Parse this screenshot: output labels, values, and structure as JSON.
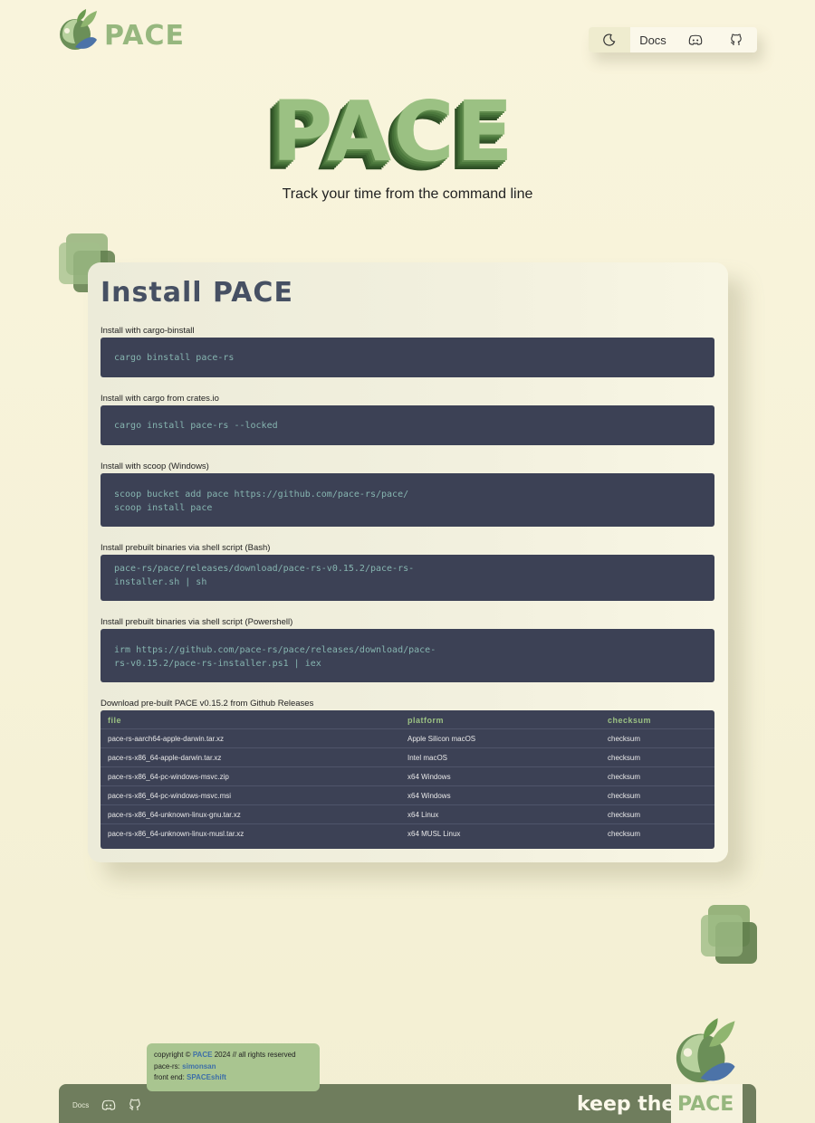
{
  "header": {
    "brand": "PACE",
    "nav": {
      "docs_label": "Docs"
    }
  },
  "hero": {
    "title": "PACE",
    "tagline": "Track your time from the command line"
  },
  "install": {
    "title": "Install PACE",
    "sections": [
      {
        "label": "Install with cargo-binstall",
        "lines": [
          "cargo binstall pace-rs"
        ]
      },
      {
        "label": "Install with cargo from crates.io",
        "lines": [
          "cargo install pace-rs --locked"
        ]
      },
      {
        "label": "Install with scoop (Windows)",
        "lines": [
          "scoop bucket add pace https://github.com/pace-rs/pace/",
          "scoop install pace"
        ]
      },
      {
        "label": "Install prebuilt binaries via shell script (Bash)",
        "lines": [
          "pace-rs/pace/releases/download/pace-rs-v0.15.2/pace-rs-",
          "installer.sh | sh"
        ]
      },
      {
        "label": "Install prebuilt binaries via shell script (Powershell)",
        "lines": [
          "irm https://github.com/pace-rs/pace/releases/download/pace-",
          "rs-v0.15.2/pace-rs-installer.ps1 | iex"
        ]
      }
    ],
    "downloads": {
      "label": "Download pre-built PACE v0.15.2 from Github Releases",
      "columns": [
        "file",
        "platform",
        "checksum"
      ],
      "rows": [
        [
          "pace-rs-aarch64-apple-darwin.tar.xz",
          "Apple Silicon macOS",
          "checksum"
        ],
        [
          "pace-rs-x86_64-apple-darwin.tar.xz",
          "Intel macOS",
          "checksum"
        ],
        [
          "pace-rs-x86_64-pc-windows-msvc.zip",
          "x64 Windows",
          "checksum"
        ],
        [
          "pace-rs-x86_64-pc-windows-msvc.msi",
          "x64 Windows",
          "checksum"
        ],
        [
          "pace-rs-x86_64-unknown-linux-gnu.tar.xz",
          "x64 Linux",
          "checksum"
        ],
        [
          "pace-rs-x86_64-unknown-linux-musl.tar.xz",
          "x64 MUSL Linux",
          "checksum"
        ]
      ]
    }
  },
  "footer": {
    "docs_label": "Docs",
    "keep_the": "keep the",
    "pace": "PACE",
    "credits": {
      "copyright_prefix": "copyright ©",
      "copyright_brand": "PACE",
      "copyright_suffix": "2024 // all rights reserved",
      "pace_rs_label": "pace-rs:",
      "pace_rs_author": "simonsan",
      "front_end_label": "front end:",
      "front_end_author": "SPACEshift"
    }
  },
  "colors": {
    "brand_green": "#96b77e",
    "code_bg": "#3c4155",
    "code_text": "#86b5b0",
    "title_slate": "#465063",
    "footer_bar": "#6f7d5d"
  },
  "icons": [
    "leaf-logo-icon",
    "moon-icon",
    "discord-icon",
    "github-icon"
  ]
}
